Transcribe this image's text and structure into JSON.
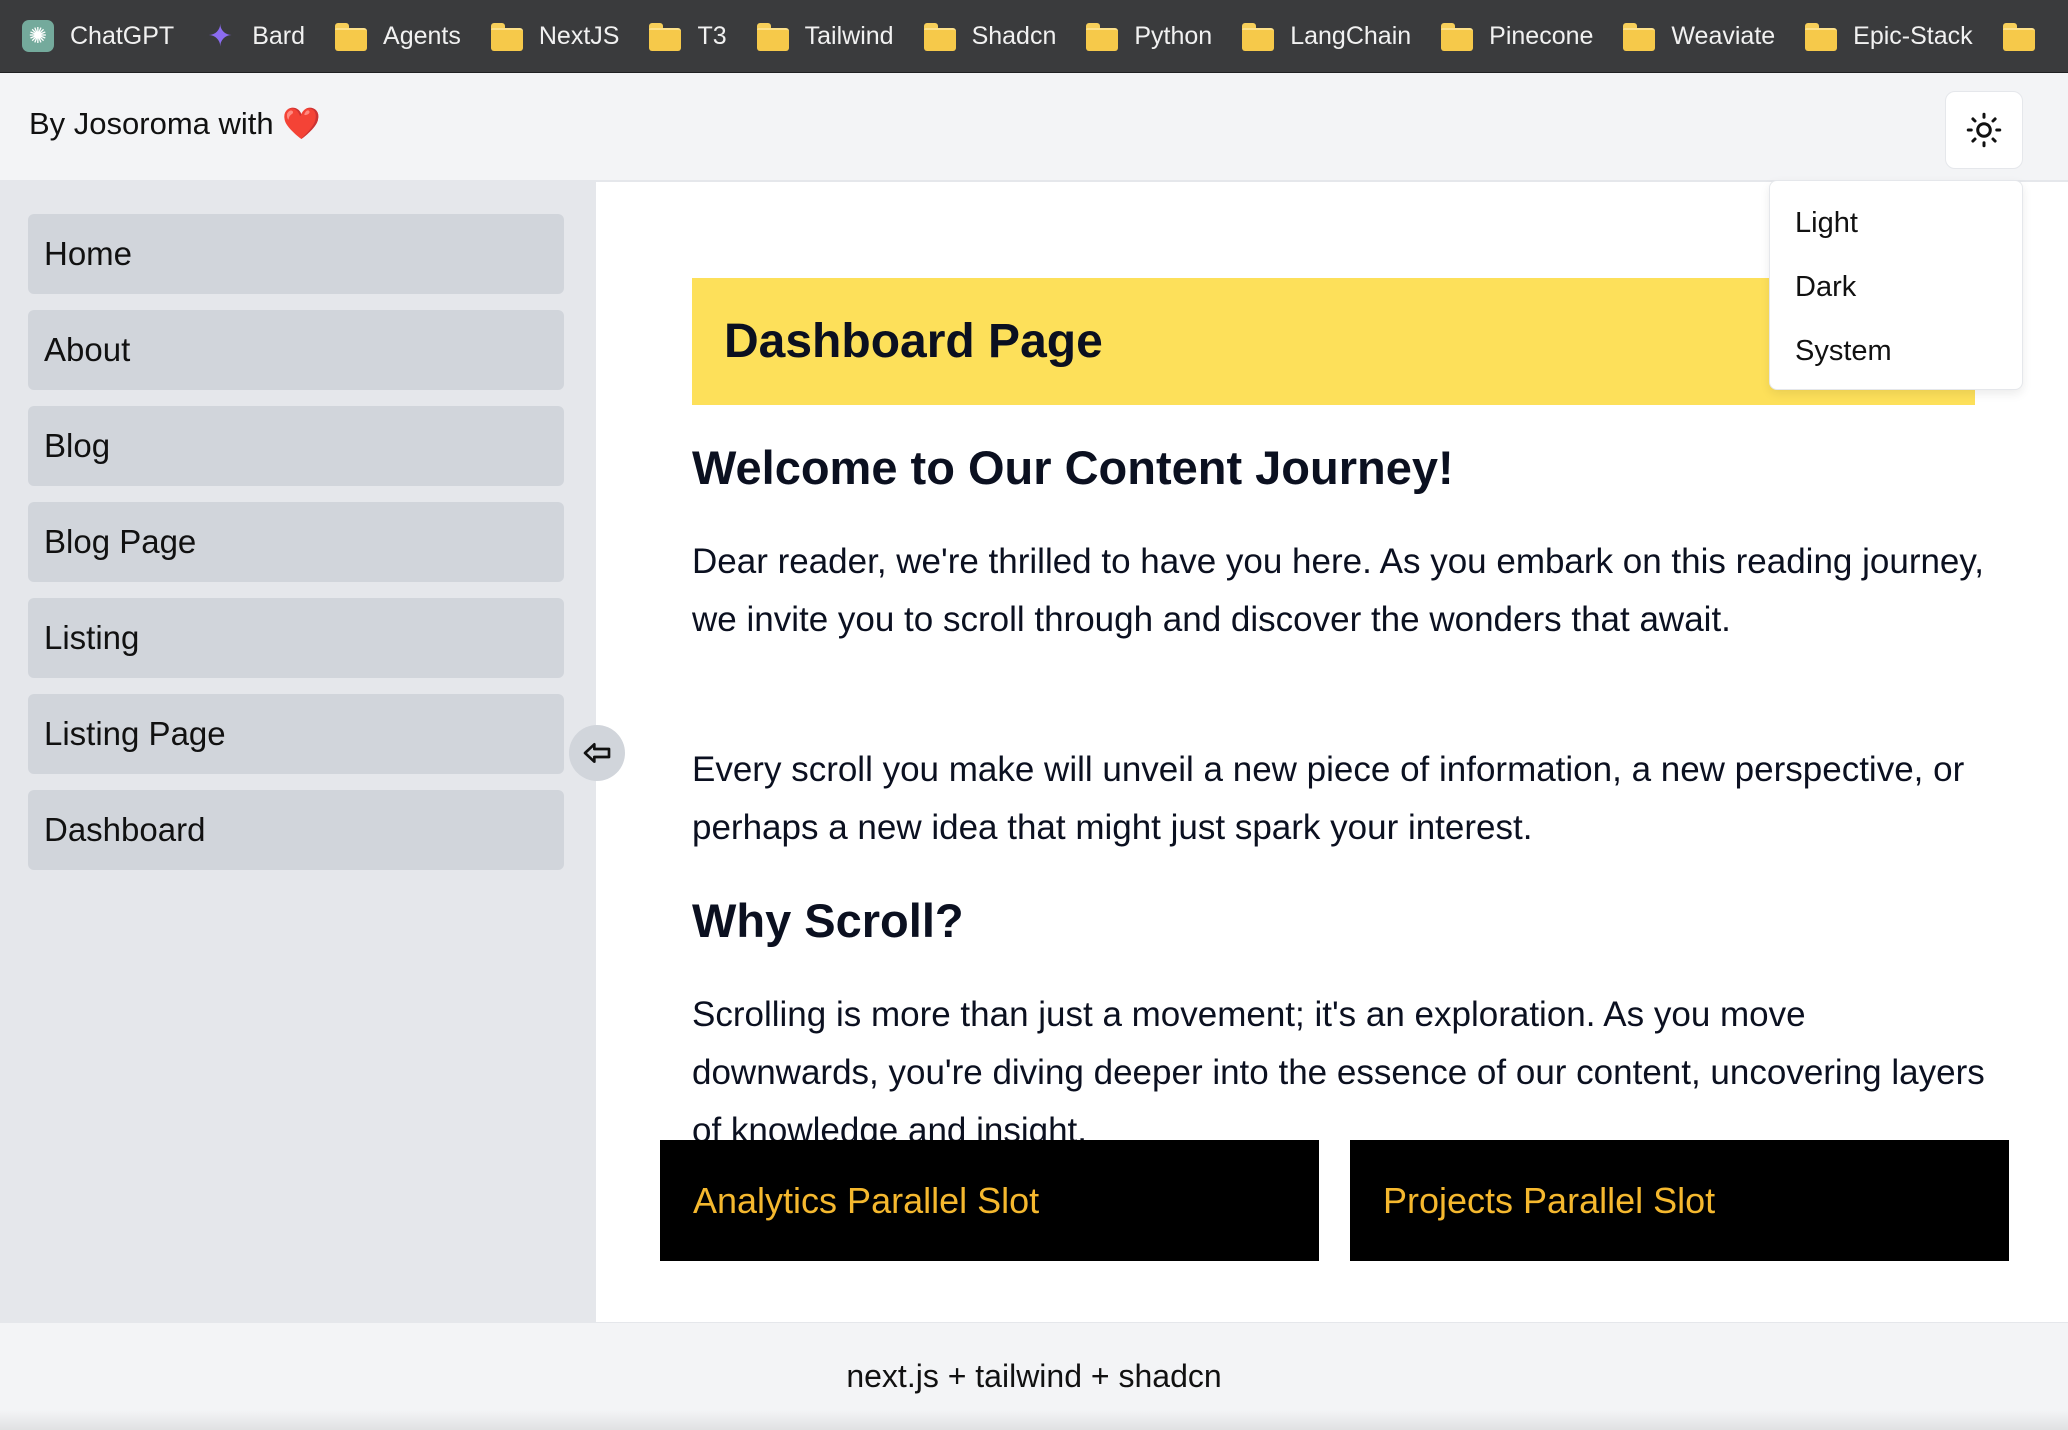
{
  "bookmarks": [
    {
      "label": "ChatGPT",
      "icon": "chatgpt-icon"
    },
    {
      "label": "Bard",
      "icon": "bard-sparkle-icon"
    },
    {
      "label": "Agents",
      "icon": "folder-icon"
    },
    {
      "label": "NextJS",
      "icon": "folder-icon"
    },
    {
      "label": "T3",
      "icon": "folder-icon"
    },
    {
      "label": "Tailwind",
      "icon": "folder-icon"
    },
    {
      "label": "Shadcn",
      "icon": "folder-icon"
    },
    {
      "label": "Python",
      "icon": "folder-icon"
    },
    {
      "label": "LangChain",
      "icon": "folder-icon"
    },
    {
      "label": "Pinecone",
      "icon": "folder-icon"
    },
    {
      "label": "Weaviate",
      "icon": "folder-icon"
    },
    {
      "label": "Epic-Stack",
      "icon": "folder-icon"
    }
  ],
  "header": {
    "brand_text": "By Josoroma with",
    "brand_emoji": "❤️",
    "theme_icon": "sun-icon"
  },
  "theme_menu": {
    "options": [
      "Light",
      "Dark",
      "System"
    ]
  },
  "sidebar": {
    "items": [
      {
        "label": "Home"
      },
      {
        "label": "About"
      },
      {
        "label": "Blog"
      },
      {
        "label": "Blog Page"
      },
      {
        "label": "Listing"
      },
      {
        "label": "Listing Page"
      },
      {
        "label": "Dashboard"
      }
    ],
    "collapse_icon": "arrow-left-icon"
  },
  "main": {
    "banner_title": "Dashboard Page",
    "heading_1": "Welcome to Our Content Journey!",
    "para_1": "Dear reader, we're thrilled to have you here. As you embark on this reading journey, we invite you to scroll through and discover the wonders that await.",
    "para_2": "Every scroll you make will unveil a new piece of information, a new perspective, or perhaps a new idea that might just spark your interest.",
    "heading_2": "Why Scroll?",
    "para_3": "Scrolling is more than just a movement; it's an exploration. As you move downwards, you're diving deeper into the essence of our content, uncovering layers of knowledge and insight.",
    "slots": [
      {
        "label": "Analytics Parallel Slot"
      },
      {
        "label": "Projects Parallel Slot"
      }
    ]
  },
  "footer": {
    "text": "next.js + tailwind + shadcn"
  },
  "colors": {
    "banner": "#fde05a",
    "slot_background": "#000000",
    "slot_text": "#f5b82e",
    "sidebar_item": "#d1d5db"
  }
}
